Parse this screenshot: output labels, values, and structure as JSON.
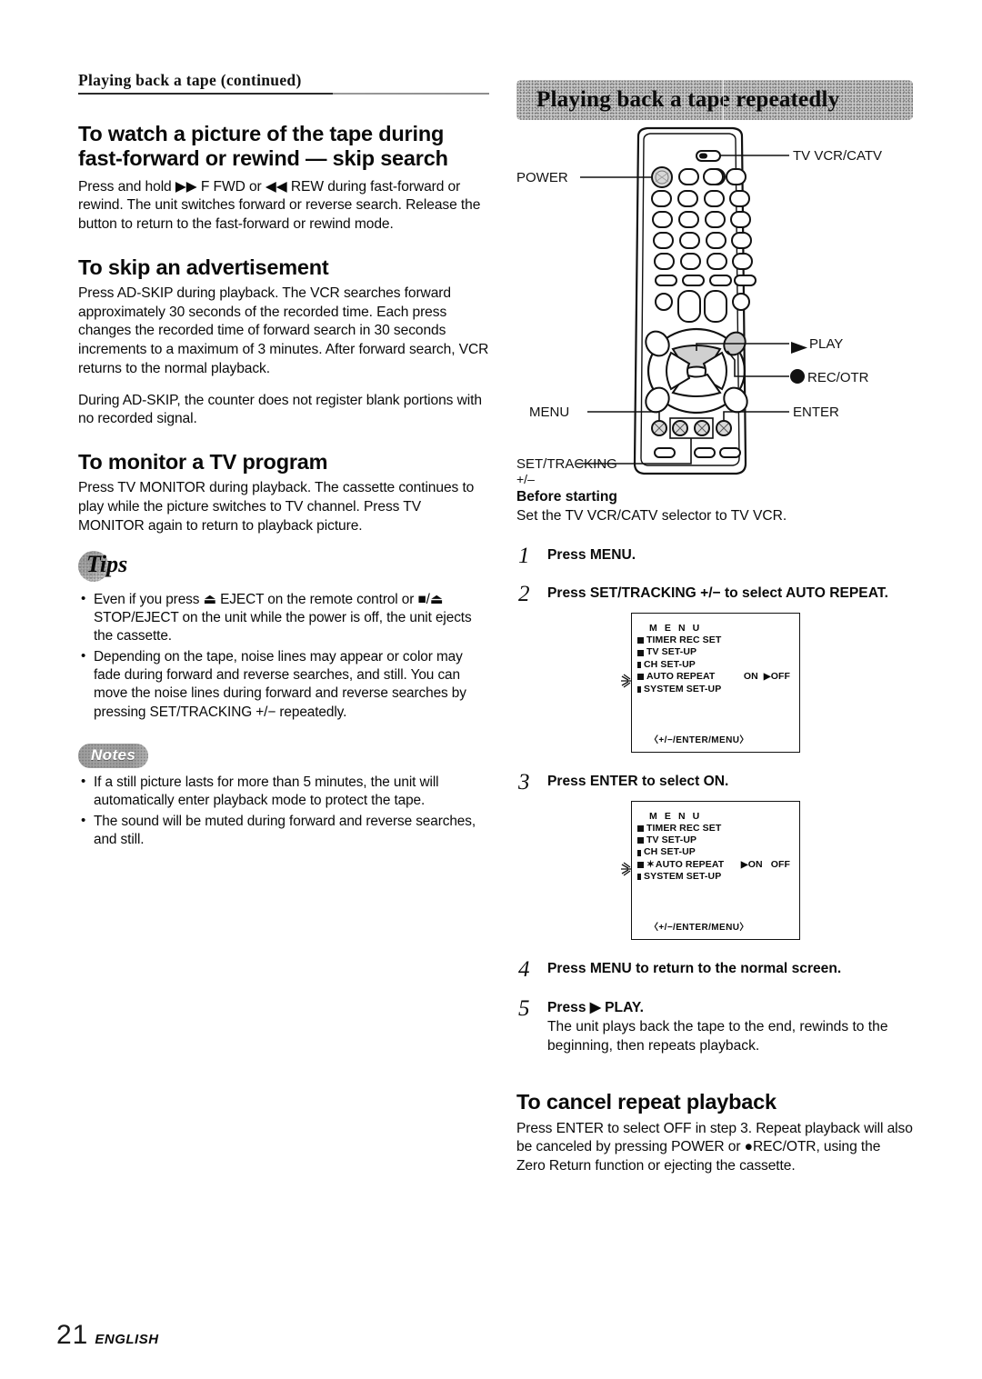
{
  "page": {
    "folio_number": "21",
    "folio_language": "ENGLISH",
    "running_head": "Playing back a tape (continued)"
  },
  "left_column": {
    "section1": {
      "heading": "To watch a picture of the tape during fast-forward or rewind — skip search",
      "paragraph": "Press and hold ▶▶ F FWD or ◀◀ REW during fast-forward or rewind.  The unit switches forward or reverse search. Release the button to return to the fast-forward or rewind mode."
    },
    "section2": {
      "heading": "To skip an advertisement",
      "paragraph1": "Press AD-SKIP during playback. The VCR searches forward approximately 30 seconds of the recorded time. Each press changes the recorded time of forward search in 30 seconds increments to a maximum of 3 minutes. After forward search, VCR returns to the normal playback.",
      "paragraph2": "During AD-SKIP, the counter does not register blank portions with no recorded signal."
    },
    "section3": {
      "heading": "To monitor a TV program",
      "paragraph": "Press TV MONITOR during playback.  The cassette continues to play while the picture switches to TV channel. Press TV MONITOR again to return to playback picture."
    },
    "tips": {
      "label": "Tips",
      "items": [
        "Even if you press ⏏ EJECT on the remote control or ■/⏏ STOP/EJECT on the unit while the power is off, the unit ejects the cassette.",
        "Depending on the tape, noise lines may appear or color may fade during forward and reverse searches, and still.  You can move the noise lines during forward and reverse searches by pressing SET/TRACKING +/−  repeatedly."
      ]
    },
    "notes": {
      "label": "Notes",
      "items": [
        "If a still picture lasts for more than 5 minutes, the unit will automatically enter playback mode to protect the tape.",
        "The sound will be muted during forward and reverse searches, and still."
      ]
    }
  },
  "right_column": {
    "banner_title": "Playing back a tape repeatedly",
    "remote_callouts": {
      "tv_vcr_catv": "TV VCR/CATV",
      "power": "POWER",
      "play": "PLAY",
      "rec_otr": "REC/OTR",
      "menu": "MENU",
      "enter": "ENTER",
      "set_tracking": "SET/TRACKING",
      "set_tracking_sub": "+/−"
    },
    "before_starting": {
      "heading": "Before starting",
      "text": "Set the TV VCR/CATV selector to TV VCR."
    },
    "steps": [
      {
        "num": "1",
        "title": "Press MENU."
      },
      {
        "num": "2",
        "title": "Press SET/TRACKING +/− to select AUTO REPEAT."
      },
      {
        "num": "3",
        "title": "Press ENTER to select ON."
      },
      {
        "num": "4",
        "title": "Press MENU to return to the normal screen."
      },
      {
        "num": "5",
        "title": "Press ▶ PLAY.",
        "body": "The unit plays back the tape to the end, rewinds to the beginning, then repeats playback."
      }
    ],
    "osd_screen_1": {
      "title": "M E N U",
      "rows": [
        {
          "label": "TIMER REC SET",
          "options": ""
        },
        {
          "label": "TV SET-UP",
          "options": ""
        },
        {
          "label": "CH SET-UP",
          "options": ""
        },
        {
          "label": "AUTO REPEAT",
          "option_on": "ON",
          "option_off": "OFF",
          "selected": "OFF"
        },
        {
          "label": "SYSTEM SET-UP",
          "options": ""
        }
      ],
      "footer": "〈+/−/ENTER/MENU〉"
    },
    "osd_screen_2": {
      "title": "M E N U",
      "rows": [
        {
          "label": "TIMER REC SET",
          "options": ""
        },
        {
          "label": "TV SET-UP",
          "options": ""
        },
        {
          "label": "CH SET-UP",
          "options": ""
        },
        {
          "label": "AUTO REPEAT",
          "option_on": "ON",
          "option_off": "OFF",
          "selected": "ON"
        },
        {
          "label": "SYSTEM SET-UP",
          "options": ""
        }
      ],
      "footer": "〈+/−/ENTER/MENU〉"
    },
    "cancel_section": {
      "heading": "To cancel repeat playback",
      "paragraph": "Press ENTER to select OFF in step 3.  Repeat playback will also be canceled by pressing POWER or ●REC/OTR, using the Zero Return function or ejecting the cassette."
    }
  }
}
